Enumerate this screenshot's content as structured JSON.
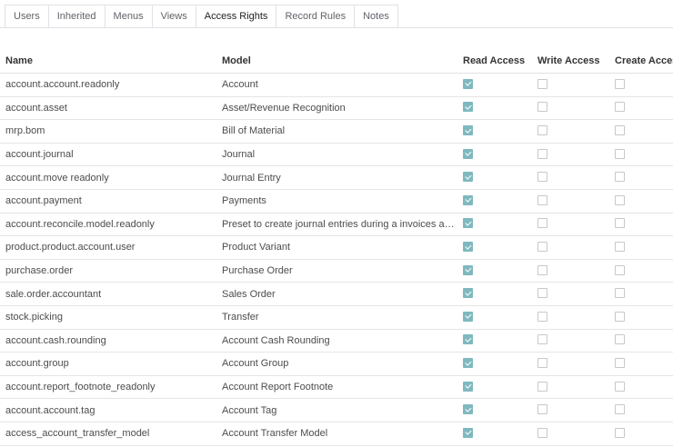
{
  "tabs": [
    {
      "label": "Users",
      "active": false
    },
    {
      "label": "Inherited",
      "active": false
    },
    {
      "label": "Menus",
      "active": false
    },
    {
      "label": "Views",
      "active": false
    },
    {
      "label": "Access Rights",
      "active": true
    },
    {
      "label": "Record Rules",
      "active": false
    },
    {
      "label": "Notes",
      "active": false
    }
  ],
  "table": {
    "columns": [
      "Name",
      "Model",
      "Read Access",
      "Write Access",
      "Create Access"
    ],
    "rows": [
      {
        "name": "account.account.readonly",
        "model": "Account",
        "read": true,
        "write": false,
        "create": false
      },
      {
        "name": "account.asset",
        "model": "Asset/Revenue Recognition",
        "read": true,
        "write": false,
        "create": false
      },
      {
        "name": "mrp.bom",
        "model": "Bill of Material",
        "read": true,
        "write": false,
        "create": false
      },
      {
        "name": "account.journal",
        "model": "Journal",
        "read": true,
        "write": false,
        "create": false
      },
      {
        "name": "account.move readonly",
        "model": "Journal Entry",
        "read": true,
        "write": false,
        "create": false
      },
      {
        "name": "account.payment",
        "model": "Payments",
        "read": true,
        "write": false,
        "create": false
      },
      {
        "name": "account.reconcile.model.readonly",
        "model": "Preset to create journal entries during a invoices and pa...",
        "read": true,
        "write": false,
        "create": false
      },
      {
        "name": "product.product.account.user",
        "model": "Product Variant",
        "read": true,
        "write": false,
        "create": false
      },
      {
        "name": "purchase.order",
        "model": "Purchase Order",
        "read": true,
        "write": false,
        "create": false
      },
      {
        "name": "sale.order.accountant",
        "model": "Sales Order",
        "read": true,
        "write": false,
        "create": false
      },
      {
        "name": "stock.picking",
        "model": "Transfer",
        "read": true,
        "write": false,
        "create": false
      },
      {
        "name": "account.cash.rounding",
        "model": "Account Cash Rounding",
        "read": true,
        "write": false,
        "create": false
      },
      {
        "name": "account.group",
        "model": "Account Group",
        "read": true,
        "write": false,
        "create": false
      },
      {
        "name": "account.report_footnote_readonly",
        "model": "Account Report Footnote",
        "read": true,
        "write": false,
        "create": false
      },
      {
        "name": "account.account.tag",
        "model": "Account Tag",
        "read": true,
        "write": false,
        "create": false
      },
      {
        "name": "access_account_transfer_model",
        "model": "Account Transfer Model",
        "read": true,
        "write": false,
        "create": false
      }
    ]
  }
}
